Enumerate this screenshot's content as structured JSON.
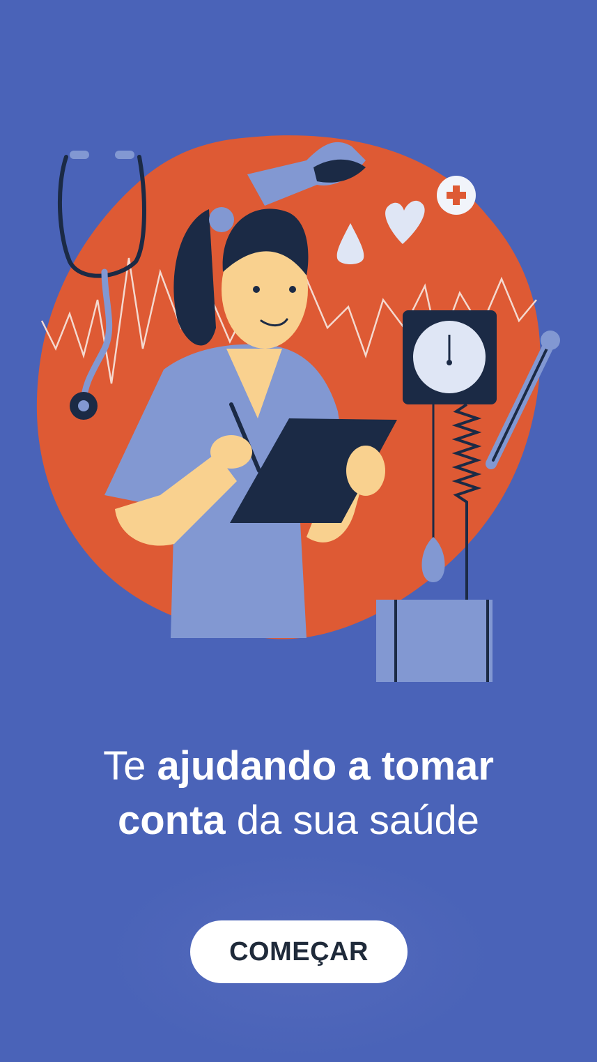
{
  "hero": {
    "headline_part1": "Te ",
    "headline_bold1": "ajudando a tomar",
    "headline_bold2": "conta",
    "headline_part2": " da sua saúde"
  },
  "cta": {
    "label": "COMEÇAR"
  },
  "colors": {
    "background": "#4a63b8",
    "blob": "#de5a34",
    "navy": "#1b2a45",
    "lavender": "#8298d2",
    "skin": "#f9d18f",
    "white": "#ffffff"
  },
  "illustration": {
    "icons": [
      "stethoscope-icon",
      "glove-icon",
      "cross-badge-icon",
      "heart-icon",
      "drop-icon",
      "sphygmomanometer-icon",
      "thermometer-icon",
      "clipboard-icon",
      "nurse-figure"
    ]
  }
}
